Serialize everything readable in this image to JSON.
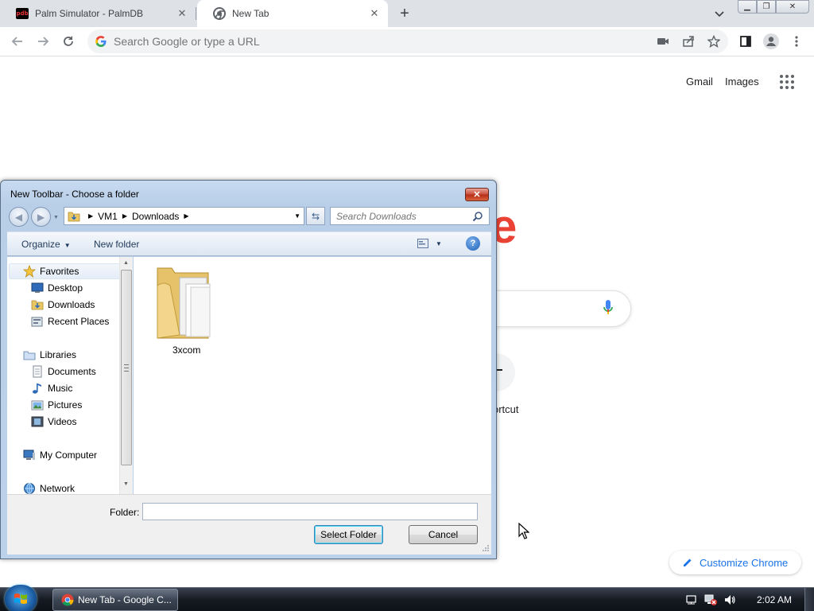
{
  "browser": {
    "tabs": [
      {
        "title": "Palm Simulator - PalmDB",
        "favicon": "pdb-icon",
        "favicon_text": "pdb"
      },
      {
        "title": "New Tab",
        "favicon": "chrome-icon"
      }
    ],
    "omnibox_placeholder": "Search Google or type a URL"
  },
  "page": {
    "gmail": "Gmail",
    "images": "Images",
    "logo_fragment": "e",
    "shortcut_label_fragment": "ortcut",
    "customize_label": "Customize Chrome"
  },
  "dialog": {
    "title": "New Toolbar - Choose a folder",
    "breadcrumb": [
      "VM1",
      "Downloads"
    ],
    "search_placeholder": "Search Downloads",
    "organize_label": "Organize",
    "new_folder_label": "New folder",
    "help_glyph": "?",
    "nav": {
      "favorites": "Favorites",
      "desktop": "Desktop",
      "downloads": "Downloads",
      "recent_places": "Recent Places",
      "libraries": "Libraries",
      "documents": "Documents",
      "music": "Music",
      "pictures": "Pictures",
      "videos": "Videos",
      "my_computer": "My Computer",
      "network": "Network"
    },
    "files": [
      {
        "name": "3xcom"
      }
    ],
    "folder_label": "Folder:",
    "folder_value": "",
    "select_button": "Select Folder",
    "cancel_button": "Cancel"
  },
  "taskbar": {
    "task_label": "New Tab - Google C...",
    "clock": "2:02 AM"
  },
  "colors": {
    "google_red": "#ea4335",
    "chrome_blue": "#1a73e8",
    "win7_title": "#b9cfe8"
  }
}
